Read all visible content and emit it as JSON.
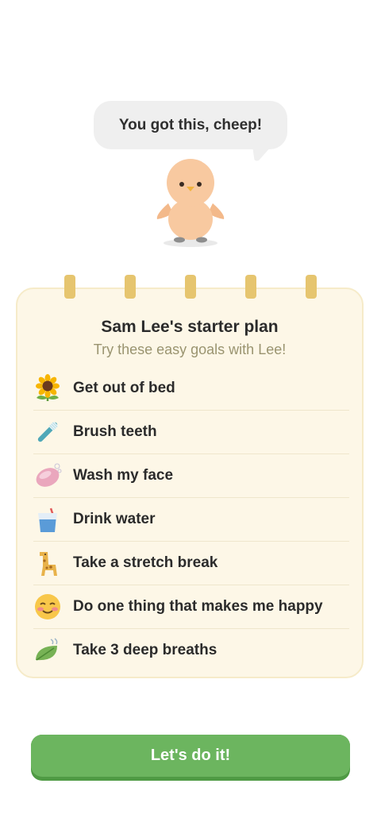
{
  "mascot": {
    "speech": "You got this, cheep!",
    "icon": "chick-mascot-icon"
  },
  "plan": {
    "title": "Sam Lee's starter plan",
    "subtitle": "Try these easy goals with Lee!",
    "goals": [
      {
        "label": "Get out of bed",
        "icon": "sunflower-icon"
      },
      {
        "label": "Brush teeth",
        "icon": "toothbrush-icon"
      },
      {
        "label": "Wash my face",
        "icon": "soap-icon"
      },
      {
        "label": "Drink water",
        "icon": "water-glass-icon"
      },
      {
        "label": "Take a stretch break",
        "icon": "giraffe-icon"
      },
      {
        "label": "Do one thing that makes me happy",
        "icon": "smiling-face-icon"
      },
      {
        "label": "Take 3 deep breaths",
        "icon": "leaf-wind-icon"
      }
    ]
  },
  "cta": {
    "label": "Let's do it!"
  },
  "colors": {
    "accent_green": "#6cb55f",
    "card_background": "#fdf7e7",
    "ring_gold": "#e6c56f",
    "subtitle_olive": "#9a9470"
  }
}
